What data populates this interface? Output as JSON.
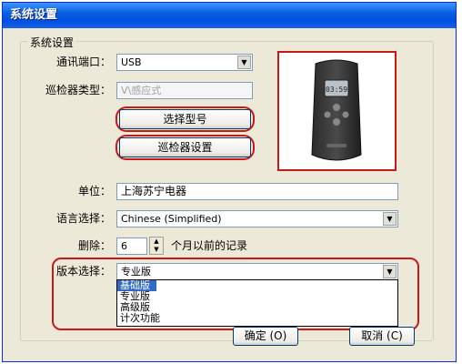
{
  "window": {
    "title": "系统设置"
  },
  "group": {
    "label": "系统设置"
  },
  "port": {
    "label": "通讯端口：",
    "value": "USB"
  },
  "device_type": {
    "label": "巡检器类型：",
    "value": "V\\感应式"
  },
  "buttons": {
    "select_model": "选择型号",
    "device_settings": "巡检器设置",
    "ok": "确定 (O)",
    "cancel": "取消 (C)"
  },
  "unit": {
    "label": "单位：",
    "value": "上海苏宁电器"
  },
  "language": {
    "label": "语言选择：",
    "value": "Chinese (Simplified)"
  },
  "delete": {
    "label": "删除：",
    "value": "6",
    "suffix": "个月以前的记录"
  },
  "version": {
    "label": "版本选择：",
    "value": "专业版",
    "options": [
      "基础版",
      "专业版",
      "高级版",
      "计次功能"
    ],
    "highlighted_index": 0
  },
  "device_screen": {
    "text": "03:59"
  },
  "colors": {
    "highlight_outline": "#c81818",
    "title_bar": "#0a5fe0",
    "selection": "#316ac5"
  }
}
